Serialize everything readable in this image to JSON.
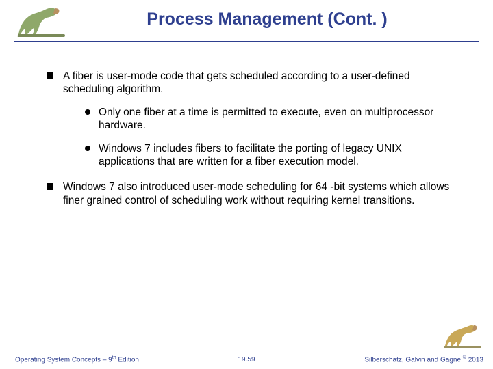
{
  "slide": {
    "title": "Process Management (Cont. )"
  },
  "bullets": {
    "b1": "A fiber is user-mode code that gets scheduled according to a user-defined scheduling algorithm.",
    "b1a": "Only one fiber at a time is permitted to execute, even on multiprocessor hardware.",
    "b1b": "Windows 7 includes fibers to facilitate the porting of legacy UNIX applications that are written for a fiber execution model.",
    "b2": "Windows 7 also introduced user-mode scheduling for 64 -bit systems which allows finer grained control of scheduling work without requiring kernel transitions."
  },
  "footer": {
    "left_prefix": "Operating System Concepts – 9",
    "left_suffix": " Edition",
    "left_sup": "th",
    "center": "19.59",
    "right_prefix": "Silberschatz, Galvin and Gagne ",
    "right_sup": "©",
    "right_suffix": " 2013"
  }
}
